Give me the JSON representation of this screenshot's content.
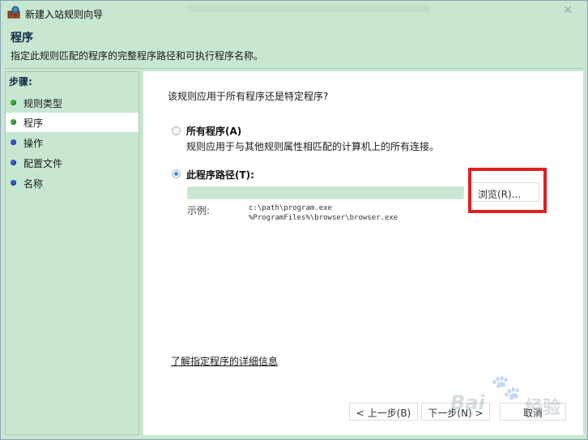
{
  "window": {
    "title": "新建入站规则向导",
    "close_label": "✕"
  },
  "header": {
    "title": "程序",
    "description": "指定此规则匹配的程序的完整程序路径和可执行程序名称。"
  },
  "steps": {
    "title": "步骤:",
    "items": [
      {
        "label": "规则类型",
        "dot_color": "#3fa63f"
      },
      {
        "label": "程序",
        "dot_color": "#3fa63f",
        "active": true
      },
      {
        "label": "操作",
        "dot_color": "#3a56c8"
      },
      {
        "label": "配置文件",
        "dot_color": "#3a56c8"
      },
      {
        "label": "名称",
        "dot_color": "#3a56c8"
      }
    ]
  },
  "content": {
    "question": "该规则应用于所有程序还是特定程序?",
    "option_all": {
      "label": "所有程序(A)",
      "description": "规则应用于与其他规则属性相匹配的计算机上的所有连接。",
      "checked": false
    },
    "option_path": {
      "label": "此程序路径(T):",
      "checked": true,
      "value": ""
    },
    "browse_label": "浏览(R)...",
    "example_label": "示例:",
    "example_lines": [
      "c:\\path\\program.exe",
      "%ProgramFiles%\\browser\\browser.exe"
    ],
    "learn_more": "了解指定程序的详细信息"
  },
  "buttons": {
    "back": "< 上一步(B)",
    "next": "下一步(N) >",
    "cancel": "取消"
  },
  "watermark": {
    "brand": "Bai",
    "suffix": "经验"
  },
  "colors": {
    "panel": "#c7e7d0",
    "highlight": "#e02020",
    "radio_checked": "#3a8fd6"
  }
}
